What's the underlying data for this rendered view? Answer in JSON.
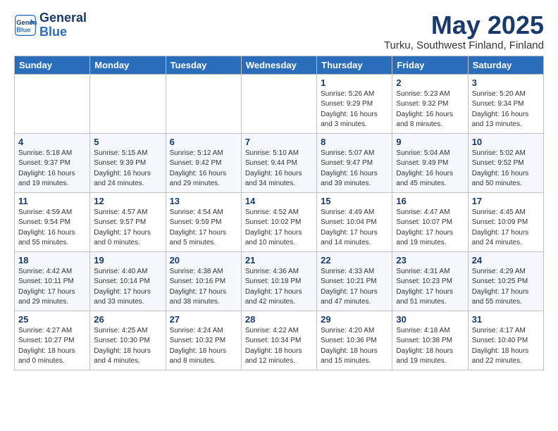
{
  "logo": {
    "line1": "General",
    "line2": "Blue"
  },
  "title": "May 2025",
  "location": "Turku, Southwest Finland, Finland",
  "days_of_week": [
    "Sunday",
    "Monday",
    "Tuesday",
    "Wednesday",
    "Thursday",
    "Friday",
    "Saturday"
  ],
  "weeks": [
    [
      {
        "day": null
      },
      {
        "day": null
      },
      {
        "day": null
      },
      {
        "day": null
      },
      {
        "day": 1,
        "sunrise": "Sunrise: 5:26 AM",
        "sunset": "Sunset: 9:29 PM",
        "daylight": "Daylight: 16 hours and 3 minutes."
      },
      {
        "day": 2,
        "sunrise": "Sunrise: 5:23 AM",
        "sunset": "Sunset: 9:32 PM",
        "daylight": "Daylight: 16 hours and 8 minutes."
      },
      {
        "day": 3,
        "sunrise": "Sunrise: 5:20 AM",
        "sunset": "Sunset: 9:34 PM",
        "daylight": "Daylight: 16 hours and 13 minutes."
      }
    ],
    [
      {
        "day": 4,
        "sunrise": "Sunrise: 5:18 AM",
        "sunset": "Sunset: 9:37 PM",
        "daylight": "Daylight: 16 hours and 19 minutes."
      },
      {
        "day": 5,
        "sunrise": "Sunrise: 5:15 AM",
        "sunset": "Sunset: 9:39 PM",
        "daylight": "Daylight: 16 hours and 24 minutes."
      },
      {
        "day": 6,
        "sunrise": "Sunrise: 5:12 AM",
        "sunset": "Sunset: 9:42 PM",
        "daylight": "Daylight: 16 hours and 29 minutes."
      },
      {
        "day": 7,
        "sunrise": "Sunrise: 5:10 AM",
        "sunset": "Sunset: 9:44 PM",
        "daylight": "Daylight: 16 hours and 34 minutes."
      },
      {
        "day": 8,
        "sunrise": "Sunrise: 5:07 AM",
        "sunset": "Sunset: 9:47 PM",
        "daylight": "Daylight: 16 hours and 39 minutes."
      },
      {
        "day": 9,
        "sunrise": "Sunrise: 5:04 AM",
        "sunset": "Sunset: 9:49 PM",
        "daylight": "Daylight: 16 hours and 45 minutes."
      },
      {
        "day": 10,
        "sunrise": "Sunrise: 5:02 AM",
        "sunset": "Sunset: 9:52 PM",
        "daylight": "Daylight: 16 hours and 50 minutes."
      }
    ],
    [
      {
        "day": 11,
        "sunrise": "Sunrise: 4:59 AM",
        "sunset": "Sunset: 9:54 PM",
        "daylight": "Daylight: 16 hours and 55 minutes."
      },
      {
        "day": 12,
        "sunrise": "Sunrise: 4:57 AM",
        "sunset": "Sunset: 9:57 PM",
        "daylight": "Daylight: 17 hours and 0 minutes."
      },
      {
        "day": 13,
        "sunrise": "Sunrise: 4:54 AM",
        "sunset": "Sunset: 9:59 PM",
        "daylight": "Daylight: 17 hours and 5 minutes."
      },
      {
        "day": 14,
        "sunrise": "Sunrise: 4:52 AM",
        "sunset": "Sunset: 10:02 PM",
        "daylight": "Daylight: 17 hours and 10 minutes."
      },
      {
        "day": 15,
        "sunrise": "Sunrise: 4:49 AM",
        "sunset": "Sunset: 10:04 PM",
        "daylight": "Daylight: 17 hours and 14 minutes."
      },
      {
        "day": 16,
        "sunrise": "Sunrise: 4:47 AM",
        "sunset": "Sunset: 10:07 PM",
        "daylight": "Daylight: 17 hours and 19 minutes."
      },
      {
        "day": 17,
        "sunrise": "Sunrise: 4:45 AM",
        "sunset": "Sunset: 10:09 PM",
        "daylight": "Daylight: 17 hours and 24 minutes."
      }
    ],
    [
      {
        "day": 18,
        "sunrise": "Sunrise: 4:42 AM",
        "sunset": "Sunset: 10:11 PM",
        "daylight": "Daylight: 17 hours and 29 minutes."
      },
      {
        "day": 19,
        "sunrise": "Sunrise: 4:40 AM",
        "sunset": "Sunset: 10:14 PM",
        "daylight": "Daylight: 17 hours and 33 minutes."
      },
      {
        "day": 20,
        "sunrise": "Sunrise: 4:38 AM",
        "sunset": "Sunset: 10:16 PM",
        "daylight": "Daylight: 17 hours and 38 minutes."
      },
      {
        "day": 21,
        "sunrise": "Sunrise: 4:36 AM",
        "sunset": "Sunset: 10:18 PM",
        "daylight": "Daylight: 17 hours and 42 minutes."
      },
      {
        "day": 22,
        "sunrise": "Sunrise: 4:33 AM",
        "sunset": "Sunset: 10:21 PM",
        "daylight": "Daylight: 17 hours and 47 minutes."
      },
      {
        "day": 23,
        "sunrise": "Sunrise: 4:31 AM",
        "sunset": "Sunset: 10:23 PM",
        "daylight": "Daylight: 17 hours and 51 minutes."
      },
      {
        "day": 24,
        "sunrise": "Sunrise: 4:29 AM",
        "sunset": "Sunset: 10:25 PM",
        "daylight": "Daylight: 17 hours and 55 minutes."
      }
    ],
    [
      {
        "day": 25,
        "sunrise": "Sunrise: 4:27 AM",
        "sunset": "Sunset: 10:27 PM",
        "daylight": "Daylight: 18 hours and 0 minutes."
      },
      {
        "day": 26,
        "sunrise": "Sunrise: 4:25 AM",
        "sunset": "Sunset: 10:30 PM",
        "daylight": "Daylight: 18 hours and 4 minutes."
      },
      {
        "day": 27,
        "sunrise": "Sunrise: 4:24 AM",
        "sunset": "Sunset: 10:32 PM",
        "daylight": "Daylight: 18 hours and 8 minutes."
      },
      {
        "day": 28,
        "sunrise": "Sunrise: 4:22 AM",
        "sunset": "Sunset: 10:34 PM",
        "daylight": "Daylight: 18 hours and 12 minutes."
      },
      {
        "day": 29,
        "sunrise": "Sunrise: 4:20 AM",
        "sunset": "Sunset: 10:36 PM",
        "daylight": "Daylight: 18 hours and 15 minutes."
      },
      {
        "day": 30,
        "sunrise": "Sunrise: 4:18 AM",
        "sunset": "Sunset: 10:38 PM",
        "daylight": "Daylight: 18 hours and 19 minutes."
      },
      {
        "day": 31,
        "sunrise": "Sunrise: 4:17 AM",
        "sunset": "Sunset: 10:40 PM",
        "daylight": "Daylight: 18 hours and 22 minutes."
      }
    ]
  ]
}
